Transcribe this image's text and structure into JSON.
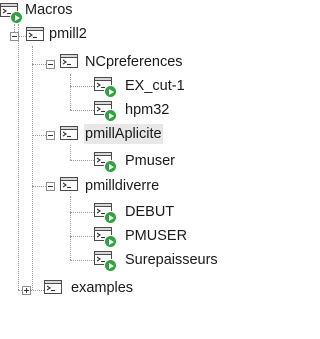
{
  "tree": {
    "root": {
      "label": "Macros"
    },
    "pmill2": {
      "label": "pmill2"
    },
    "ncpreferences": {
      "label": "NCpreferences"
    },
    "ex_cut": {
      "label": "EX_cut-1"
    },
    "hpm32": {
      "label": "hpm32"
    },
    "pmillaplicite": {
      "label": "pmillAplicite",
      "selected": true
    },
    "pmuser_lower": {
      "label": "Pmuser"
    },
    "pmilldiverre": {
      "label": "pmilldiverre"
    },
    "debut": {
      "label": "DEBUT"
    },
    "pmuser_upper": {
      "label": "PMUSER"
    },
    "surepaisseurs": {
      "label": "Surepaisseurs"
    },
    "examples": {
      "label": "examples",
      "collapsed": true
    }
  }
}
